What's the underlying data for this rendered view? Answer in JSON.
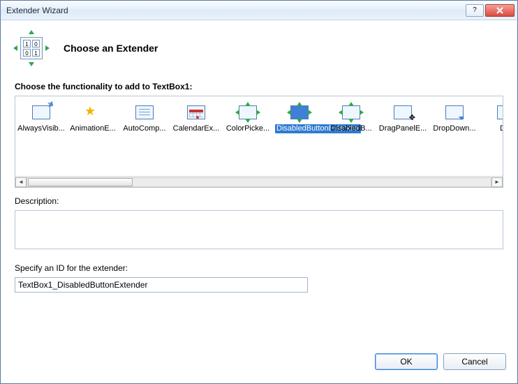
{
  "window": {
    "title": "Extender Wizard"
  },
  "header": {
    "page_title": "Choose an Extender"
  },
  "list": {
    "label": "Choose the functionality to add to TextBox1:",
    "items": [
      {
        "label": "AlwaysVisib...",
        "icon": "always-visible"
      },
      {
        "label": "AnimationE...",
        "icon": "animation"
      },
      {
        "label": "AutoComp...",
        "icon": "autocomplete"
      },
      {
        "label": "CalendarEx...",
        "icon": "calendar"
      },
      {
        "label": "ColorPicke...",
        "icon": "colorpicker"
      },
      {
        "label": "DisabledButtonExtender",
        "icon": "disabled-button",
        "selected": true
      },
      {
        "label": "DisabledB...",
        "icon": "disabled-button2"
      },
      {
        "label": "DragPanelE...",
        "icon": "drag-panel"
      },
      {
        "label": "DropDown...",
        "icon": "dropdown"
      },
      {
        "label": "Dro",
        "icon": "dropdown2"
      }
    ]
  },
  "description": {
    "label": "Description:",
    "text": ""
  },
  "id_field": {
    "label": "Specify an ID for the extender:",
    "value": "TextBox1_DisabledButtonExtender"
  },
  "buttons": {
    "ok": "OK",
    "cancel": "Cancel"
  }
}
